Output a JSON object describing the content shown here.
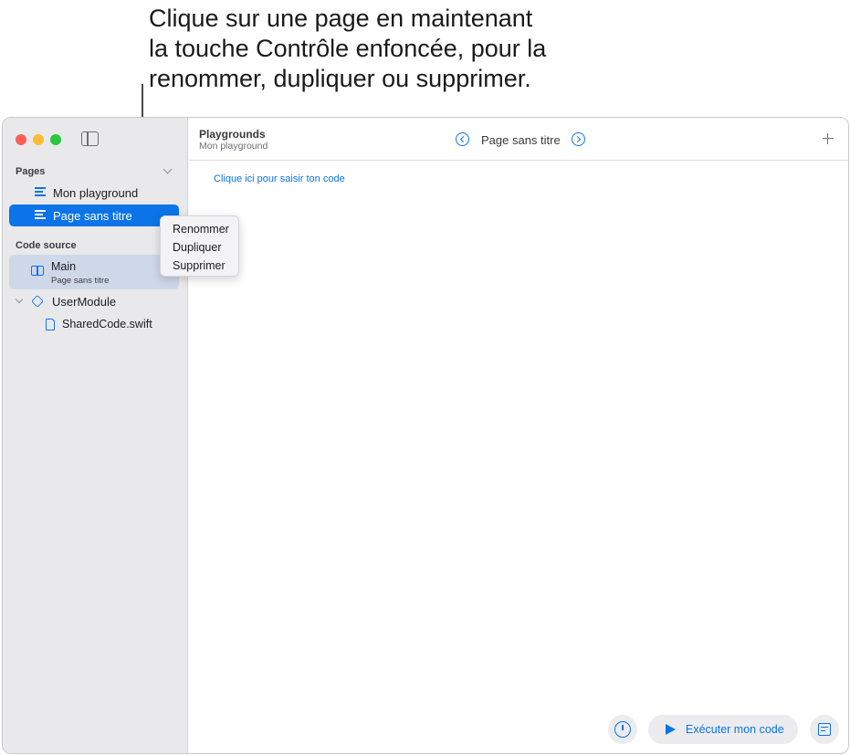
{
  "callout": {
    "line1": "Clique sur une page en maintenant",
    "line2": "la touche Contrôle enfoncée, pour la",
    "line3": "renommer, dupliquer ou supprimer."
  },
  "sidebar": {
    "pages_title": "Pages",
    "pages": [
      {
        "label": "Mon playground",
        "icon": "page-lines-icon",
        "selected": false
      },
      {
        "label": "Page sans titre",
        "icon": "page-lines-icon",
        "selected": true
      }
    ],
    "code_title": "Code source",
    "main": {
      "label": "Main",
      "sublabel": "Page sans titre",
      "icon": "book-icon"
    },
    "module": {
      "label": "UserModule",
      "icon": "cube-icon"
    },
    "file": {
      "label": "SharedCode.swift",
      "icon": "doc-icon"
    }
  },
  "context_menu": {
    "items": [
      "Renommer",
      "Dupliquer",
      "Supprimer"
    ]
  },
  "topbar": {
    "title": "Playgrounds",
    "subtitle": "Mon playground",
    "page_title": "Page sans titre"
  },
  "editor": {
    "placeholder": "Clique ici pour saisir ton code"
  },
  "bottom": {
    "run_label": "Exécuter mon code"
  },
  "colors": {
    "accent": "#0a74e8",
    "sidebar_bg": "#e9e9eb",
    "selected_row": "#0a74e8",
    "main_row": "#cfd8e9"
  }
}
